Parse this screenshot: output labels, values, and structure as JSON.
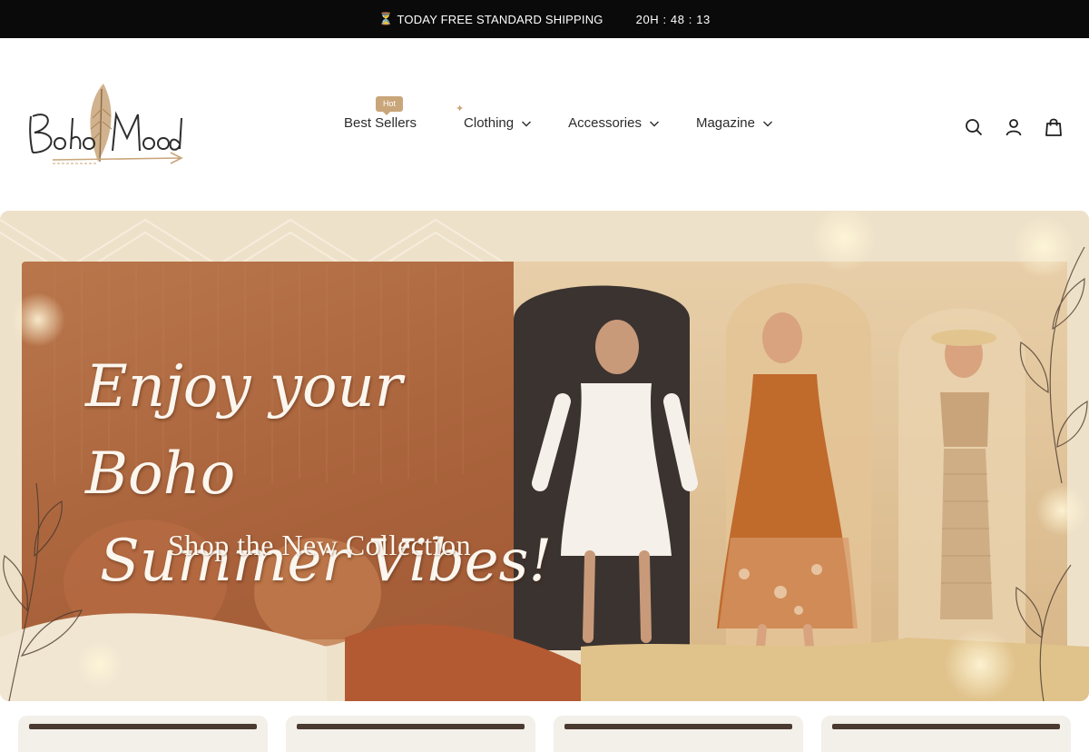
{
  "announcement": {
    "icon": "hourglass-icon",
    "icon_glyph": "⏳",
    "text": "TODAY FREE STANDARD SHIPPING",
    "timer": "20H : 48 : 13"
  },
  "header": {
    "logo_text": "Boho Mood",
    "nav": [
      {
        "label": "Best Sellers",
        "badge": "Hot",
        "has_dropdown": false
      },
      {
        "label": "Clothing",
        "has_dropdown": true
      },
      {
        "label": "Accessories",
        "has_dropdown": true
      },
      {
        "label": "Magazine",
        "has_dropdown": true
      }
    ],
    "icons": [
      "search-icon",
      "account-icon",
      "cart-icon"
    ]
  },
  "hero": {
    "title_line1": "Enjoy your Boho",
    "title_line2": "Summer Vibes!",
    "subtitle": "Shop the New Collection"
  },
  "colors": {
    "announcement_bg": "#0a0a0a",
    "accent": "#c9a57a",
    "text": "#2b2b2b",
    "hero_terracotta": "#b0663f"
  },
  "product_cards": [
    {
      "name": "product-card-1"
    },
    {
      "name": "product-card-2"
    },
    {
      "name": "product-card-3"
    },
    {
      "name": "product-card-4"
    }
  ]
}
